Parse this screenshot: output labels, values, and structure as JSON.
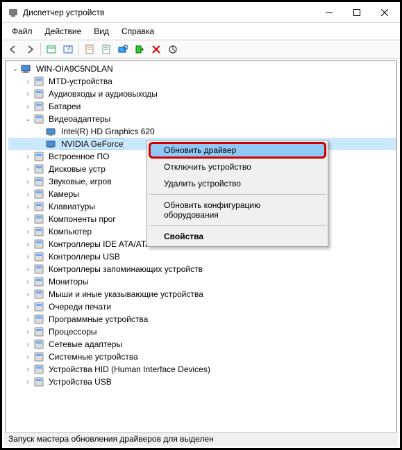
{
  "window": {
    "title": "Диспетчер устройств"
  },
  "menubar": {
    "file": "Файл",
    "action": "Действие",
    "view": "Вид",
    "help": "Справка"
  },
  "tree": {
    "root": "WIN-OIA9C5NDLAN",
    "items": [
      {
        "label": "MTD-устройства",
        "exp": ">"
      },
      {
        "label": "Аудиовходы и аудиовыходы",
        "exp": ">"
      },
      {
        "label": "Батареи",
        "exp": ">"
      },
      {
        "label": "Видеоадаптеры",
        "exp": "v",
        "children": [
          {
            "label": "Intel(R) HD Graphics 620"
          },
          {
            "label": "NVIDIA GeForce",
            "selected": true
          }
        ]
      },
      {
        "label": "Встроенное ПО",
        "exp": ">"
      },
      {
        "label": "Дисковые устр",
        "exp": ">"
      },
      {
        "label": "Звуковые, игров",
        "exp": ">"
      },
      {
        "label": "Камеры",
        "exp": ">"
      },
      {
        "label": "Клавиатуры",
        "exp": ">"
      },
      {
        "label": "Компоненты прог",
        "exp": ">"
      },
      {
        "label": "Компьютер",
        "exp": ">"
      },
      {
        "label": "Контроллеры IDE ATA/ATAPI",
        "exp": ">"
      },
      {
        "label": "Контроллеры USB",
        "exp": ">"
      },
      {
        "label": "Контроллеры запоминающих устройств",
        "exp": ">"
      },
      {
        "label": "Мониторы",
        "exp": ">"
      },
      {
        "label": "Мыши и иные указывающие устройства",
        "exp": ">"
      },
      {
        "label": "Очереди печати",
        "exp": ">"
      },
      {
        "label": "Программные устройства",
        "exp": ">"
      },
      {
        "label": "Процессоры",
        "exp": ">"
      },
      {
        "label": "Сетевые адаптеры",
        "exp": ">"
      },
      {
        "label": "Системные устройства",
        "exp": ">"
      },
      {
        "label": "Устройства HID (Human Interface Devices)",
        "exp": ">"
      },
      {
        "label": "Устройства USB",
        "exp": ">"
      }
    ]
  },
  "context_menu": {
    "update_driver": "Обновить драйвер",
    "disable": "Отключить устройство",
    "uninstall": "Удалить устройство",
    "scan": "Обновить конфигурацию оборудования",
    "properties": "Свойства"
  },
  "statusbar": {
    "text": "Запуск мастера обновления драйверов для выделен"
  }
}
